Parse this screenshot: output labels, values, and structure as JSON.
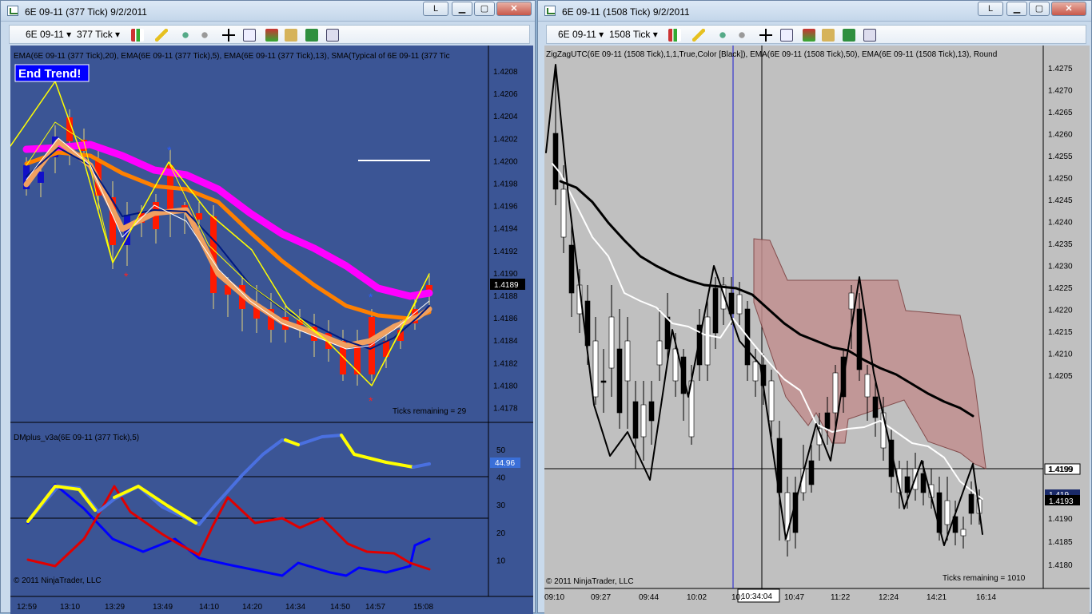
{
  "left": {
    "title": "6E 09-11 (377 Tick)  9/2/2011",
    "instrument": "6E 09-11",
    "interval": "377 Tick",
    "indicator_label": "EMA(6E 09-11 (377 Tick),20), EMA(6E 09-11 (377 Tick),5), EMA(6E 09-11 (377 Tick),13), SMA(Typical of 6E 09-11 (377 Tic",
    "alert_text": "End Trend!",
    "price_ticks": [
      "1.4208",
      "1.4206",
      "1.4204",
      "1.4202",
      "1.4200",
      "1.4198",
      "1.4196",
      "1.4194",
      "1.4192",
      "1.4190",
      "1.4188",
      "1.4186",
      "1.4184",
      "1.4182",
      "1.4180",
      "1.4178"
    ],
    "current_price": "1.4189",
    "ticks_remaining": "Ticks remaining = 29",
    "lower_label": "DMplus_v3a(6E 09-11 (377 Tick),5)",
    "lower_ticks": [
      "50",
      "40",
      "30",
      "20",
      "10"
    ],
    "lower_value": "44.96",
    "copyright": "© 2011 NinjaTrader, LLC",
    "time_ticks": [
      "12:59",
      "13:10",
      "13:29",
      "13:49",
      "14:10",
      "14:20",
      "14:34",
      "14:50",
      "14:57",
      "15:08"
    ]
  },
  "right": {
    "title": "6E 09-11 (1508 Tick)  9/2/2011",
    "instrument": "6E 09-11",
    "interval": "1508 Tick",
    "indicator_label": "ZigZagUTC(6E 09-11 (1508 Tick),1,1,True,Color [Black]), EMA(6E 09-11 (1508 Tick),50), EMA(6E 09-11 (1508 Tick),13), Round",
    "price_ticks": [
      "1.4275",
      "1.4270",
      "1.4265",
      "1.4260",
      "1.4255",
      "1.4250",
      "1.4245",
      "1.4240",
      "1.4235",
      "1.4230",
      "1.4225",
      "1.4220",
      "1.4215",
      "1.4210",
      "1.4205",
      "1.4199",
      "1.4190",
      "1.4185",
      "1.4180"
    ],
    "crosshair_price": "1.4199",
    "current_price_a": "1.419",
    "current_price_b": "1.4193",
    "ticks_remaining": "Ticks remaining = 1010",
    "copyright": "© 2011 NinjaTrader, LLC",
    "time_ticks": [
      "09:10",
      "09:27",
      "09:44",
      "10:02",
      "10:",
      "10:47",
      "11:22",
      "12:24",
      "14:21",
      "16:14"
    ],
    "crosshair_time": "10:34:04"
  },
  "window_buttons": {
    "left_l": "L",
    "right_l": "L"
  },
  "colors": {
    "left_bg": "#3b5595",
    "right_bg": "#c0c0c0",
    "magenta": "#ff00ff",
    "orange": "#ff8000",
    "yellow": "#ffff00"
  }
}
